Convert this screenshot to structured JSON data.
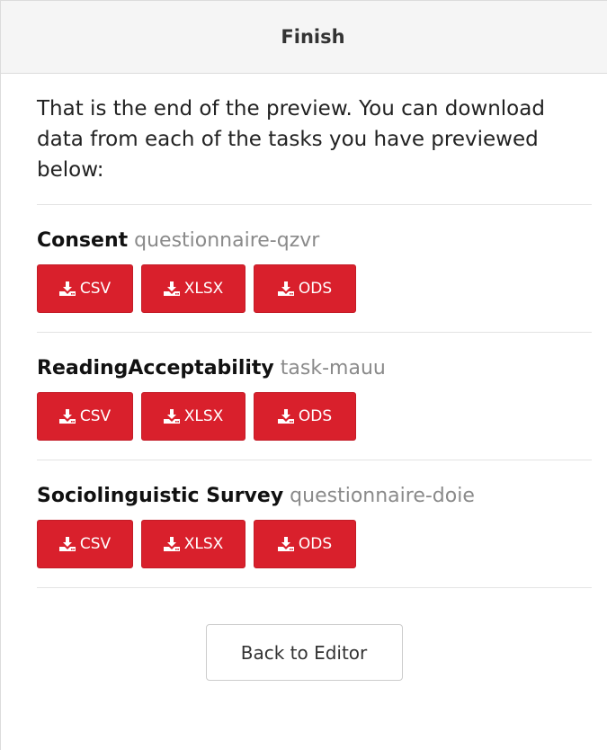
{
  "header": {
    "title": "Finish"
  },
  "intro": {
    "text": "That is the end of the preview. You can download data from each of the tasks you have previewed below:"
  },
  "tasks": [
    {
      "name": "Consent",
      "id": "questionnaire-qzvr",
      "buttons": {
        "csv": "CSV",
        "xlsx": "XLSX",
        "ods": "ODS"
      }
    },
    {
      "name": "ReadingAcceptability",
      "id": "task-mauu",
      "buttons": {
        "csv": "CSV",
        "xlsx": "XLSX",
        "ods": "ODS"
      }
    },
    {
      "name": "Sociolinguistic Survey",
      "id": "questionnaire-doie",
      "buttons": {
        "csv": "CSV",
        "xlsx": "XLSX",
        "ods": "ODS"
      }
    }
  ],
  "footer": {
    "back_label": "Back to Editor"
  },
  "icons": {
    "download": "download-icon"
  },
  "colors": {
    "button_red": "#d9202c",
    "muted_text": "#8a8a8a",
    "header_bg": "#f5f5f5"
  }
}
